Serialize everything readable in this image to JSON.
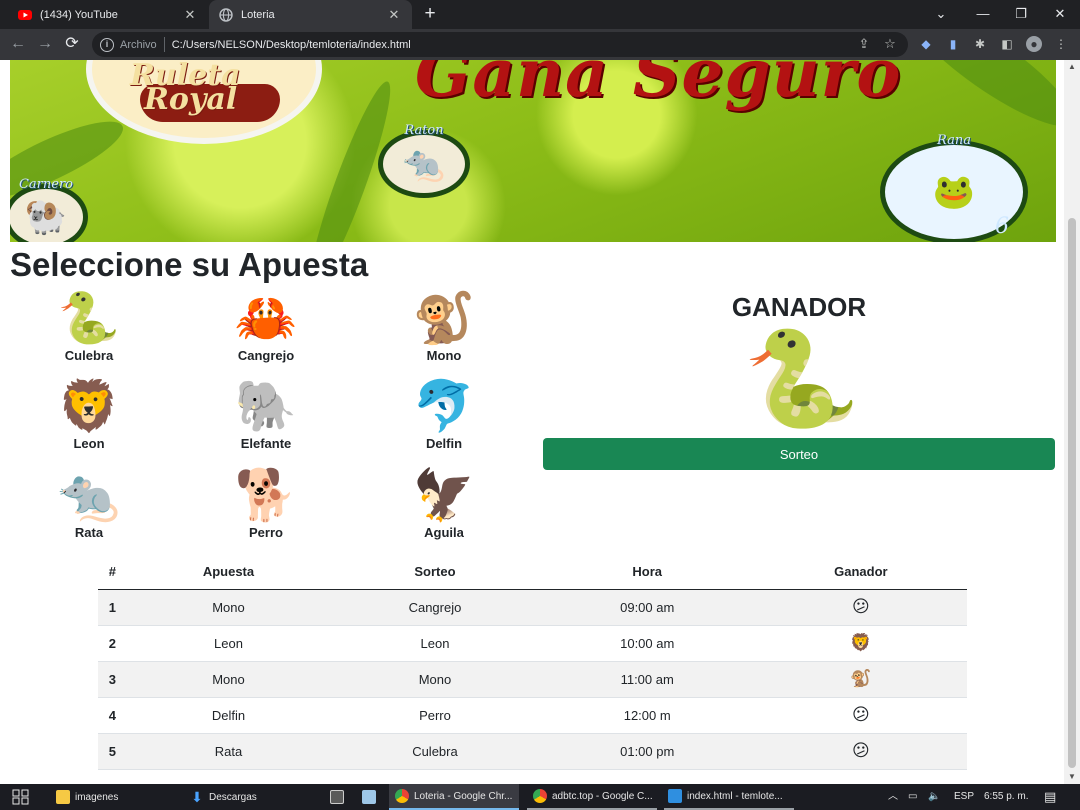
{
  "browser": {
    "tabs": [
      {
        "title": "(1434) YouTube",
        "active": false,
        "favicon": "youtube-icon"
      },
      {
        "title": "Loteria",
        "active": true,
        "favicon": "globe-icon"
      }
    ],
    "address": {
      "scheme_label": "Archivo",
      "url": "C:/Users/NELSON/Desktop/temloteria/index.html"
    }
  },
  "banner": {
    "title": "Gana Seguro",
    "logo_top": "Ruleta",
    "logo_bottom": "Royal",
    "medals": [
      {
        "label": "Carnero"
      },
      {
        "label": "Raton"
      },
      {
        "label": "Rana",
        "number": "6"
      }
    ]
  },
  "page": {
    "heading": "Seleccione su Apuesta",
    "animals": [
      {
        "name": "Culebra",
        "emoji": "🐍"
      },
      {
        "name": "Cangrejo",
        "emoji": "🦀"
      },
      {
        "name": "Mono",
        "emoji": "🐒"
      },
      {
        "name": "Leon",
        "emoji": "🦁"
      },
      {
        "name": "Elefante",
        "emoji": "🐘"
      },
      {
        "name": "Delfin",
        "emoji": "🐬"
      },
      {
        "name": "Rata",
        "emoji": "🐀"
      },
      {
        "name": "Perro",
        "emoji": "🐕"
      },
      {
        "name": "Aguila",
        "emoji": "🦅"
      }
    ],
    "winner": {
      "title": "GANADOR",
      "emoji": "🐍",
      "button": "Sorteo"
    }
  },
  "table": {
    "headers": [
      "#",
      "Apuesta",
      "Sorteo",
      "Hora",
      "Ganador"
    ],
    "rows": [
      {
        "n": "1",
        "apuesta": "Mono",
        "sorteo": "Cangrejo",
        "hora": "09:00 am",
        "ganador": "😕"
      },
      {
        "n": "2",
        "apuesta": "Leon",
        "sorteo": "Leon",
        "hora": "10:00 am",
        "ganador": "🦁"
      },
      {
        "n": "3",
        "apuesta": "Mono",
        "sorteo": "Mono",
        "hora": "11:00 am",
        "ganador": "🐒"
      },
      {
        "n": "4",
        "apuesta": "Delfin",
        "sorteo": "Perro",
        "hora": "12:00 m",
        "ganador": "😕"
      },
      {
        "n": "5",
        "apuesta": "Rata",
        "sorteo": "Culebra",
        "hora": "01:00 pm",
        "ganador": "😕"
      }
    ]
  },
  "taskbar": {
    "items": [
      {
        "label": "imagenes"
      },
      {
        "label": "Descargas"
      },
      {
        "label": "Loteria - Google Chr..."
      },
      {
        "label": "adbtc.top - Google C..."
      },
      {
        "label": "index.html - temlote..."
      }
    ],
    "lang": "ESP",
    "clock": "6:55 p. m."
  },
  "colors": {
    "sorteo_button": "#198754",
    "banner_green": "#8dbd18",
    "banner_title": "#b31212"
  }
}
